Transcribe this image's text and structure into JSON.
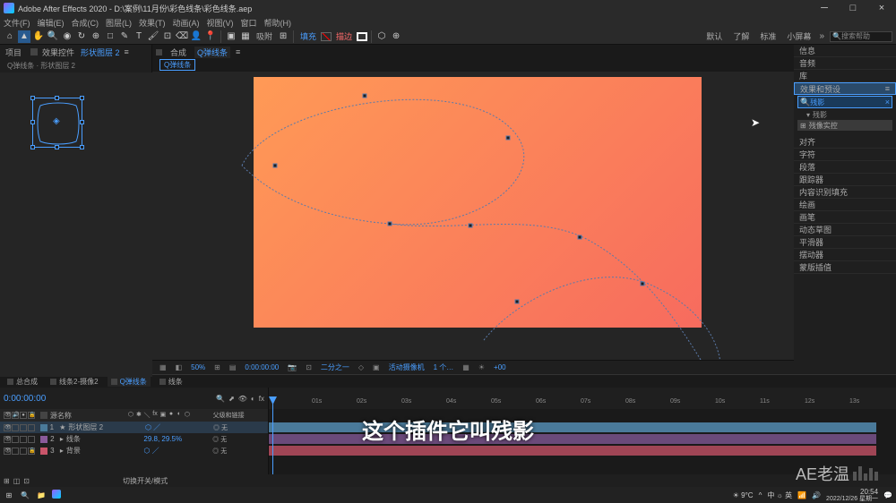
{
  "title": "Adobe After Effects 2020 - D:\\案例\\11月份\\彩色线条\\彩色线条.aep",
  "menu": [
    "文件(F)",
    "编辑(E)",
    "合成(C)",
    "图层(L)",
    "效果(T)",
    "动画(A)",
    "视图(V)",
    "窗口",
    "帮助(H)"
  ],
  "toolbar": {
    "snap_label": "吸附",
    "fill_label": "填充",
    "stroke_label": "描边",
    "workspace_items": [
      "默认",
      "了解",
      "标准",
      "小屏幕"
    ],
    "search_placeholder": "搜索帮助"
  },
  "left_panel": {
    "tab1": "项目",
    "tab2_prefix": "效果控件",
    "tab2_layer": "形状图层 2",
    "subhead": "Q弹线条 · 形状图层 2"
  },
  "comp": {
    "tab_prefix": "合成",
    "tab_name": "Q弹线条",
    "subtab": "Q弹线条"
  },
  "view_controls": {
    "zoom": "50%",
    "timecode": "0:00:00:00",
    "res": "二分之一",
    "camera": "活动摄像机",
    "views": "1 个…",
    "px": "+00"
  },
  "right_panel": {
    "items": [
      "信息",
      "音频",
      "库",
      "效果和预设"
    ],
    "search_value": "残影",
    "group": "残影",
    "effect": "残像实控",
    "rest": [
      "对齐",
      "字符",
      "段落",
      "跟踪器",
      "内容识别填充",
      "绘画",
      "画笔",
      "动态草图",
      "平滑器",
      "摆动器",
      "蒙版插值"
    ]
  },
  "timeline": {
    "tabs": [
      "总合成",
      "线条2-摄像2",
      "Q弹线条",
      "线条"
    ],
    "active_tab": 2,
    "timecode": "0:00:00:00",
    "col_source": "源名称",
    "col_parent": "父级和链接",
    "layers": [
      {
        "num": "1",
        "name": "形状图层 2",
        "color": "#4a7a9a",
        "parent": "无",
        "values": ""
      },
      {
        "num": "2",
        "name": "线条",
        "color": "#8a5a9a",
        "parent": "无",
        "values": "29.8, 29.5%"
      },
      {
        "num": "3",
        "name": "背景",
        "color": "#c9556a",
        "parent": "无",
        "values": ""
      }
    ],
    "footer": "切换开关/模式",
    "ticks": [
      "01s",
      "02s",
      "03s",
      "04s",
      "05s",
      "06s",
      "07s",
      "08s",
      "09s",
      "10s",
      "11s",
      "12s",
      "13s"
    ]
  },
  "subtitle": "这个插件它叫残影",
  "watermark": "AE老温",
  "taskbar": {
    "temp": "9°C",
    "ime": "中 ☼ 英",
    "time": "20:54",
    "date": "2022/12/26 星期一"
  }
}
